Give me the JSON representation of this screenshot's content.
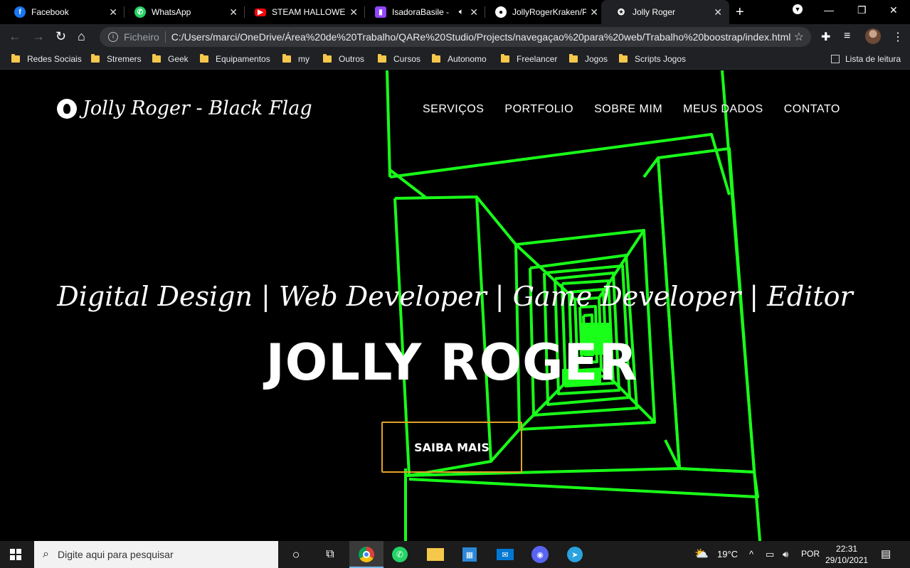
{
  "browser": {
    "tabs": [
      {
        "title": "Facebook",
        "icon": "facebook-icon",
        "color": "#1877f2"
      },
      {
        "title": "WhatsApp",
        "icon": "whatsapp-icon",
        "color": "#25d366"
      },
      {
        "title": "STEAM HALLOWEEN",
        "icon": "youtube-icon",
        "color": "#ff0000"
      },
      {
        "title": "IsadoraBasile -",
        "icon": "twitch-icon",
        "color": "#9146ff"
      },
      {
        "title": "JollyRogerKraken/P",
        "icon": "github-icon",
        "color": "#ffffff"
      },
      {
        "title": "Jolly Roger",
        "icon": "rebel-icon",
        "color": "#ffffff"
      }
    ],
    "address": {
      "label": "Ficheiro",
      "url": "C:/Users/marci/OneDrive/Área%20de%20Trabalho/QARe%20Studio/Projects/navegaçao%20para%20web/Trabalho%20boostrap/index.html"
    },
    "bookmarks": [
      "Redes Sociais",
      "Stremers",
      "Geek",
      "Equipamentos",
      "my",
      "Outros",
      "Cursos",
      "Autonomo",
      "Freelancer",
      "Jogos",
      "Scripts Jogos"
    ],
    "reading_list": "Lista de leitura"
  },
  "site": {
    "brand": "Jolly Roger - Black Flag",
    "nav": [
      "SERVIÇOS",
      "PORTFOLIO",
      "SOBRE MIM",
      "MEUS DADOS",
      "CONTATO"
    ],
    "subtitle": "Digital Design | Web Developer | Game Developer | Editor",
    "headline": "JOLLY ROGER",
    "cta": "SAIBA MAIS",
    "colors": {
      "accent": "#e0a325",
      "tunnel": "#19ff19",
      "background": "#000000"
    }
  },
  "taskbar": {
    "search_placeholder": "Digite aqui para pesquisar",
    "weather": "19°C",
    "language": "POR",
    "time": "22:31",
    "date": "29/10/2021"
  }
}
